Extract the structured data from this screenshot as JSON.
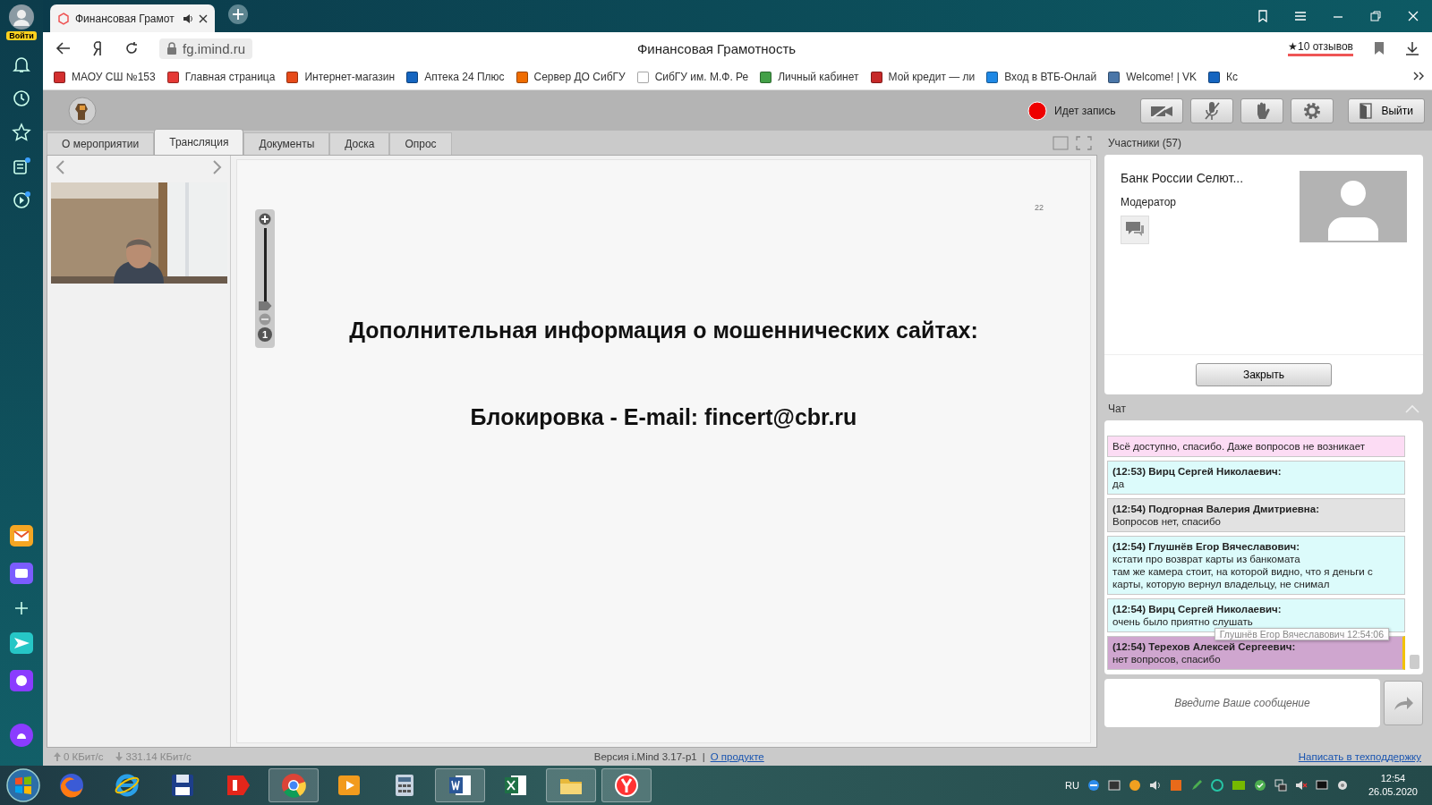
{
  "browser": {
    "login": "Войти",
    "tab": {
      "title": "Финансовая Грамот",
      "playing_sound": true
    },
    "address": "fg.imind.ru",
    "page_title": "Финансовая Грамотность",
    "reviews": "★10 отзывов",
    "bookmarks": [
      {
        "label": "МАОУ СШ №153",
        "color": "#d32f2f"
      },
      {
        "label": "Главная страница",
        "color": "#e53935"
      },
      {
        "label": "Интернет-магазин",
        "color": "#e64a19"
      },
      {
        "label": "Аптека 24 Плюс",
        "color": "#1565c0"
      },
      {
        "label": "Сервер ДО СибГУ",
        "color": "#ef6c00"
      },
      {
        "label": "СибГУ им. М.Ф. Ре",
        "color": "#ffffff"
      },
      {
        "label": "Личный кабинет",
        "color": "#43a047"
      },
      {
        "label": "Мой кредит — ли",
        "color": "#c62828"
      },
      {
        "label": "Вход в ВТБ-Онлай",
        "color": "#1e88e5"
      },
      {
        "label": "Welcome! | VK",
        "color": "#4a76a8"
      },
      {
        "label": "Кс",
        "color": "#1565c0"
      }
    ]
  },
  "app": {
    "header": {
      "recording": "Идет запись",
      "exit": "Выйти"
    },
    "tabs": [
      {
        "label": "О мероприятии",
        "selected": false
      },
      {
        "label": "Трансляция",
        "selected": true
      },
      {
        "label": "Документы",
        "selected": false
      },
      {
        "label": "Доска",
        "selected": false
      },
      {
        "label": "Опрос",
        "selected": false
      }
    ],
    "slide": {
      "page": "22",
      "lines": [
        "Дополнительная информация о мошеннических сайтах:",
        "Блокировка - E-mail: fincert@cbr.ru"
      ]
    },
    "zoom": {
      "level": 0,
      "reset": "1"
    },
    "participants": {
      "title": "Участники (57)",
      "name": "Банк России Селют...",
      "role": "Модератор",
      "close": "Закрыть"
    },
    "chat": {
      "title": "Чат",
      "messages": [
        {
          "text": [
            "Всё доступно, спасибо. Даже вопросов не возникает"
          ],
          "color": "#fcdcf4",
          "highlighted": false
        },
        {
          "author": "(12:53) Вирц Сергей Николаевич:",
          "text": [
            "да"
          ],
          "color": "#dcfbfb",
          "highlighted": false
        },
        {
          "author": "(12:54) Подгорная Валерия Дмитриевна:",
          "text": [
            "Вопросов нет, спасибо"
          ],
          "color": "#e2e2e2",
          "highlighted": false
        },
        {
          "author": "(12:54) Глушнёв Егор Вячеславович:",
          "text": [
            "кстати про возврат карты из банкомата",
            "там же камера стоит, на которой видно, что я деньги с",
            "карты, которую вернул владельцу, не снимал"
          ],
          "color": "#dcfbfb",
          "highlighted": false
        },
        {
          "author": "(12:54) Вирц Сергей Николаевич:",
          "text": [
            "очень было приятно слушать"
          ],
          "color": "#dcfbfb",
          "highlighted": false
        },
        {
          "author": "(12:54) Терехов Алексей Сергеевич:",
          "text": [
            "нет вопросов, спасибо"
          ],
          "color": "#cfa6cf",
          "highlighted": true
        }
      ],
      "tooltip": "Глушнёв Егор Вячеславович 12:54:06",
      "input": {
        "placeholder": "Введите Ваше сообщение"
      }
    },
    "status": {
      "upload": "0 КБит/с",
      "download": "331.14 КБит/с",
      "version": "Версия i.Mind 3.17-p1",
      "separator": "|",
      "about": "О продукте",
      "support": "Написать в техподдержку"
    }
  },
  "taskbar": {
    "apps": [
      {
        "kind": "fox",
        "running": false
      },
      {
        "kind": "ie",
        "running": false
      },
      {
        "kind": "floppy",
        "running": false
      },
      {
        "kind": "ya",
        "running": false
      },
      {
        "kind": "chrome",
        "running": true
      },
      {
        "kind": "media",
        "running": false
      },
      {
        "kind": "calc",
        "running": false
      },
      {
        "kind": "word",
        "running": true
      },
      {
        "kind": "excel",
        "running": false
      },
      {
        "kind": "folder",
        "running": true
      },
      {
        "kind": "yandex",
        "running": true
      }
    ],
    "language": "RU",
    "time": "12:54",
    "date": "26.05.2020"
  }
}
